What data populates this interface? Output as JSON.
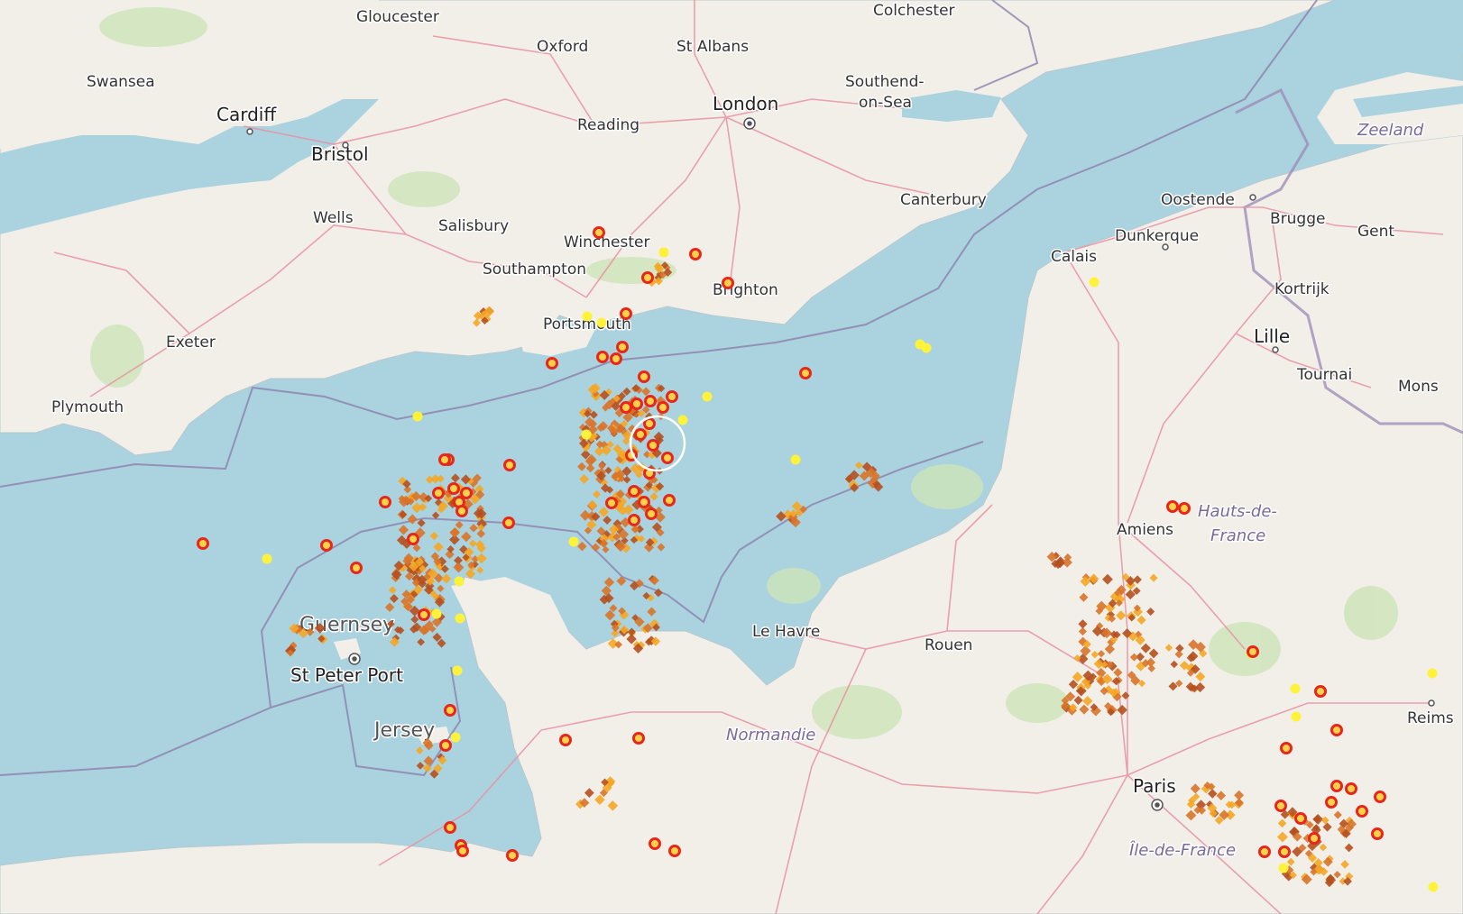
{
  "map": {
    "places": [
      {
        "id": "gloucester",
        "label": "Gloucester",
        "cls": "town"
      },
      {
        "id": "colchester",
        "label": "Colchester",
        "cls": "town"
      },
      {
        "id": "oxford",
        "label": "Oxford",
        "cls": "town"
      },
      {
        "id": "st-albans",
        "label": "St Albans",
        "cls": "town"
      },
      {
        "id": "swansea",
        "label": "Swansea",
        "cls": "town"
      },
      {
        "id": "london",
        "label": "London",
        "cls": "city"
      },
      {
        "id": "southend",
        "label": "Southend-",
        "cls": "town"
      },
      {
        "id": "southend2",
        "label": "on-Sea",
        "cls": "town"
      },
      {
        "id": "cardiff",
        "label": "Cardiff",
        "cls": "city"
      },
      {
        "id": "reading",
        "label": "Reading",
        "cls": "town"
      },
      {
        "id": "bristol",
        "label": "Bristol",
        "cls": "city"
      },
      {
        "id": "zeeland",
        "label": "Zeeland",
        "cls": "region"
      },
      {
        "id": "oostende",
        "label": "Oostende",
        "cls": "town"
      },
      {
        "id": "canterbury",
        "label": "Canterbury",
        "cls": "town"
      },
      {
        "id": "wells",
        "label": "Wells",
        "cls": "town"
      },
      {
        "id": "salisbury",
        "label": "Salisbury",
        "cls": "town"
      },
      {
        "id": "brugge",
        "label": "Brugge",
        "cls": "town"
      },
      {
        "id": "gent",
        "label": "Gent",
        "cls": "town"
      },
      {
        "id": "winchester",
        "label": "Winchester",
        "cls": "town"
      },
      {
        "id": "dunkerque",
        "label": "Dunkerque",
        "cls": "town"
      },
      {
        "id": "calais",
        "label": "Calais",
        "cls": "town"
      },
      {
        "id": "southampton",
        "label": "Southampton",
        "cls": "town"
      },
      {
        "id": "brighton",
        "label": "Brighton",
        "cls": "town"
      },
      {
        "id": "kortrijk",
        "label": "Kortrijk",
        "cls": "town"
      },
      {
        "id": "portsmouth",
        "label": "Portsmouth",
        "cls": "town"
      },
      {
        "id": "exeter",
        "label": "Exeter",
        "cls": "town"
      },
      {
        "id": "lille",
        "label": "Lille",
        "cls": "city"
      },
      {
        "id": "tournai",
        "label": "Tournai",
        "cls": "town"
      },
      {
        "id": "mons",
        "label": "Mons",
        "cls": "town"
      },
      {
        "id": "plymouth",
        "label": "Plymouth",
        "cls": "town"
      },
      {
        "id": "hauts1",
        "label": "Hauts-de-",
        "cls": "region"
      },
      {
        "id": "hauts2",
        "label": "France",
        "cls": "region"
      },
      {
        "id": "amiens",
        "label": "Amiens",
        "cls": "town"
      },
      {
        "id": "guernsey",
        "label": "Guernsey",
        "cls": "island"
      },
      {
        "id": "le-havre",
        "label": "Le Havre",
        "cls": "town"
      },
      {
        "id": "rouen",
        "label": "Rouen",
        "cls": "town"
      },
      {
        "id": "st-peter-port",
        "label": "St Peter Port",
        "cls": "city"
      },
      {
        "id": "reims",
        "label": "Reims",
        "cls": "town"
      },
      {
        "id": "jersey",
        "label": "Jersey",
        "cls": "island"
      },
      {
        "id": "normandie",
        "label": "Normandie",
        "cls": "region"
      },
      {
        "id": "paris",
        "label": "Paris",
        "cls": "city"
      },
      {
        "id": "ile-de-france",
        "label": "Île-de-France",
        "cls": "region"
      }
    ],
    "colors": {
      "sea": "#aad3df",
      "land": "#f2efe9",
      "green": "#cde5b8",
      "road": "#e892a2",
      "border": "#9e8fb8",
      "strike_new": "#e8261b",
      "strike_ring": "#ffd24a",
      "strike_recent": "#f5a623",
      "strike_older": "#d9742a",
      "strike_oldest": "#b5501f",
      "strike_fresh": "#fff23a"
    }
  }
}
